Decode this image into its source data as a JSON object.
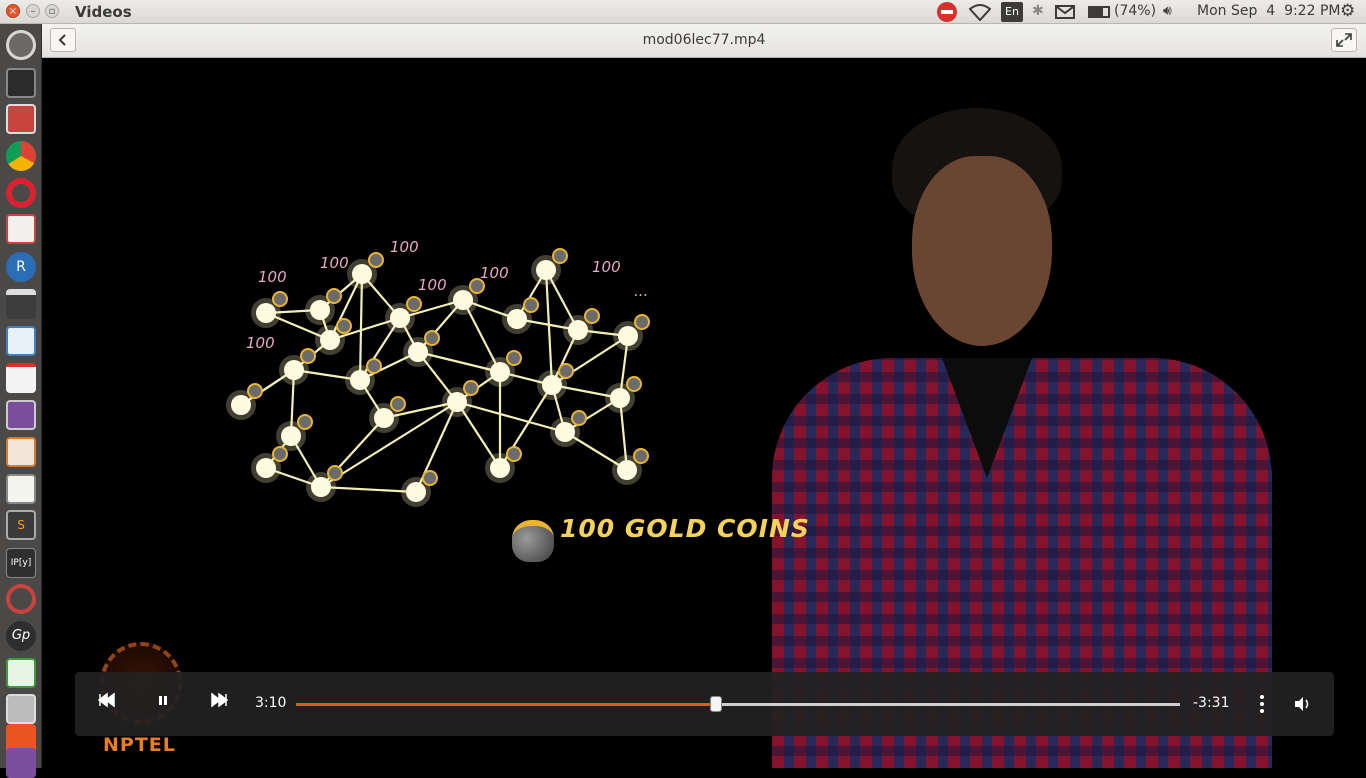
{
  "app": {
    "title": "Videos"
  },
  "tray": {
    "keyboard": "En",
    "battery": "(74%)",
    "clock": "Mon Sep  4  9:22 PM"
  },
  "player": {
    "filename": "mod06lec77.mp4",
    "elapsed": "3:10",
    "remaining": "-3:31",
    "progress": 0.475
  },
  "video": {
    "caption": "100 GOLD COINS",
    "node_labels": [
      "100",
      "100",
      "100",
      "100",
      "100",
      "100",
      "100",
      "..."
    ],
    "logo_text": "NPTEL"
  },
  "colors": {
    "accent": "#e95420",
    "node": "#fffbe0",
    "edge": "#f3efb4",
    "label": "#e9a8c6"
  }
}
